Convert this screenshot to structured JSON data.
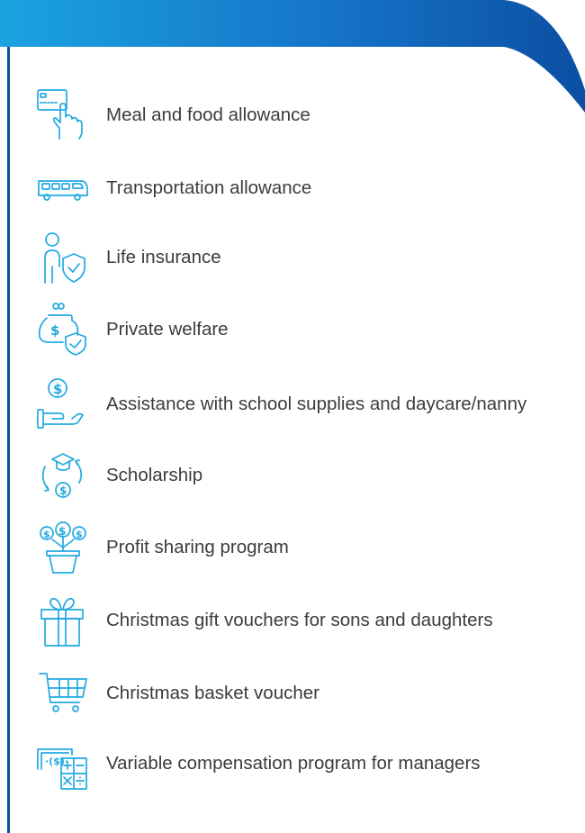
{
  "colors": {
    "header_blue": "#0b4fa3",
    "header_cyan": "#1aa3e0",
    "icon_stroke": "#21a9e1",
    "text": "#3c3c3c"
  },
  "benefits": [
    {
      "icon": "card-hand-icon",
      "label": "Meal and food allowance"
    },
    {
      "icon": "bus-icon",
      "label": "Transportation allowance"
    },
    {
      "icon": "person-shield-icon",
      "label": "Life insurance"
    },
    {
      "icon": "money-shield-icon",
      "label": "Private welfare"
    },
    {
      "icon": "hand-coin-icon",
      "label": "Assistance with school supplies and daycare/nanny"
    },
    {
      "icon": "graduation-cycle-icon",
      "label": "Scholarship"
    },
    {
      "icon": "money-plant-icon",
      "label": "Profit sharing program"
    },
    {
      "icon": "gift-icon",
      "label": "Christmas gift vouchers for sons and daughters"
    },
    {
      "icon": "shopping-cart-icon",
      "label": "Christmas basket voucher"
    },
    {
      "icon": "calculator-money-icon",
      "label": "Variable compensation program for managers"
    }
  ]
}
